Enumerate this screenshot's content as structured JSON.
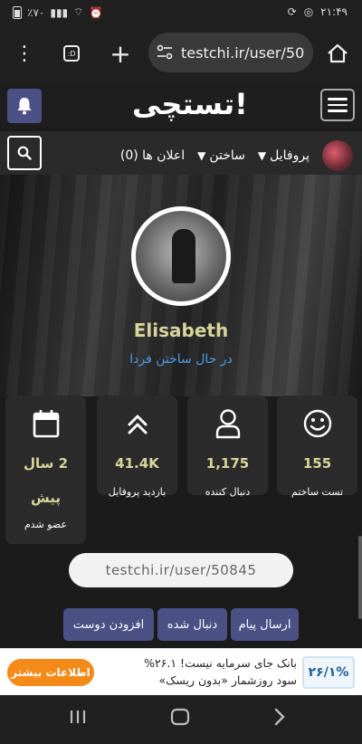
{
  "statusbar": {
    "time": "۲۱:۴۹",
    "battery": "٪۷۰"
  },
  "browser": {
    "url": "testchi.ir/user/50",
    "tab_count": ":D"
  },
  "site": {
    "logo": "تستچی!"
  },
  "nav": {
    "profile": "پروفایل",
    "build": "ساختن",
    "notifications": "اعلان ها (0)"
  },
  "profile": {
    "username": "Elisabeth",
    "status": "در حال ساختن فردا"
  },
  "stats": [
    {
      "icon": "smiley-icon",
      "value": "155",
      "label": "تست ساختم"
    },
    {
      "icon": "user-icon",
      "value": "1,175",
      "label": "دنبال کننده"
    },
    {
      "icon": "chevrons-up-icon",
      "value": "41.4K",
      "label": "بازدید پروفایل"
    },
    {
      "icon": "calendar-icon",
      "value": "2 سال",
      "value2": "پیش",
      "label": "عضو شدم"
    }
  ],
  "profile_url": "testchi.ir/user/50845",
  "actions": {
    "send_message": "ارسال پیام",
    "followed": "دنبال شده",
    "add_friend": "افزودن دوست"
  },
  "ad": {
    "badge": "۲۶/۱%",
    "line1": "بانک جای سرمایه نیست! ۲۶.۱%",
    "line2": "سود روزشمار «بدون ریسک»",
    "cta": "اطلاعات بیشتر"
  },
  "colors": {
    "accent": "#4b5185",
    "name": "#d8d59c",
    "link": "#4a9ee8",
    "cta": "#f48a18"
  }
}
